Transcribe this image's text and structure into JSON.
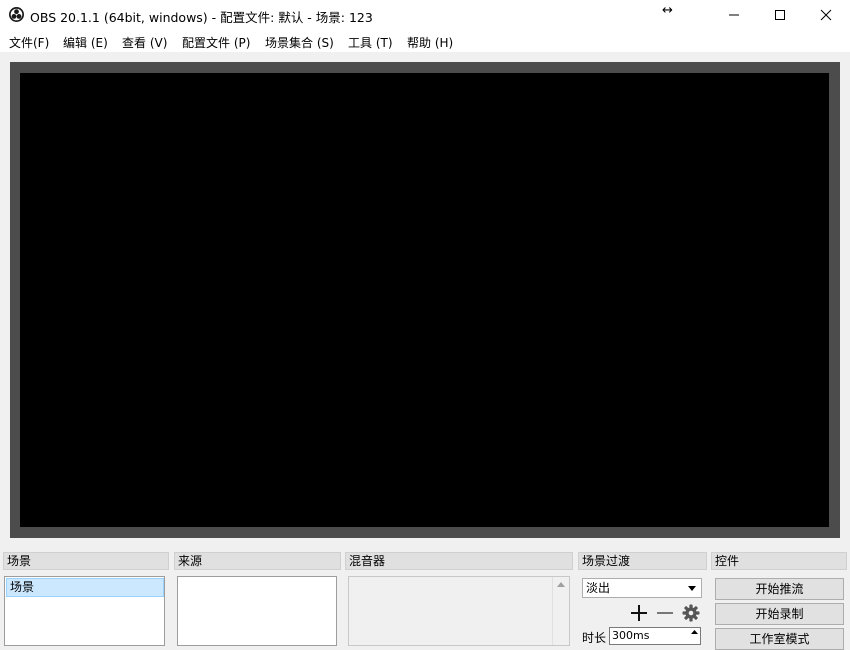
{
  "window": {
    "title": "OBS 20.1.1 (64bit, windows) - 配置文件: 默认 - 场景: 123",
    "resize_glyph": "↔",
    "icons": [
      "obs-logo-icon",
      "minimize-icon",
      "maximize-icon",
      "close-icon"
    ]
  },
  "menu": {
    "items": [
      {
        "label": "文件(F)"
      },
      {
        "label": "编辑 (E)"
      },
      {
        "label": "查看 (V)"
      },
      {
        "label": "配置文件 (P)"
      },
      {
        "label": "场景集合 (S)"
      },
      {
        "label": "工具 (T)"
      },
      {
        "label": "帮助 (H)"
      }
    ]
  },
  "docks": {
    "scenes": {
      "title": "场景",
      "items": [
        "场景"
      ]
    },
    "sources": {
      "title": "来源"
    },
    "mixer": {
      "title": "混音器"
    },
    "transitions": {
      "title": "场景过渡",
      "selected": "淡出",
      "duration_label": "时长",
      "duration_value": "300ms"
    },
    "controls": {
      "title": "控件",
      "buttons": [
        "开始推流",
        "开始录制",
        "工作室模式"
      ]
    }
  },
  "colors": {
    "preview_border": "#4c4c4c",
    "preview_canvas": "#000000",
    "selection": "#cce8ff"
  }
}
